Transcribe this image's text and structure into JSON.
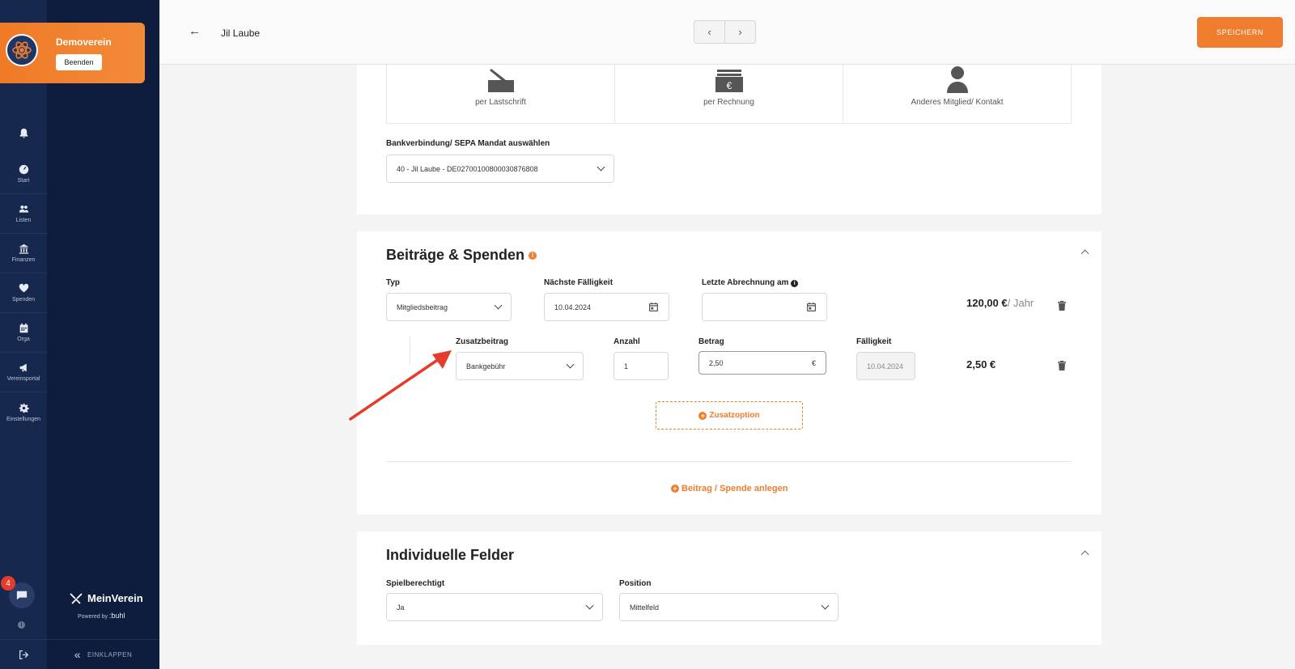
{
  "sidebar": {
    "org_name": "Demoverein",
    "org_button": "Beenden",
    "nav": [
      {
        "label": "",
        "icon": "bell-icon"
      },
      {
        "label": "Start",
        "icon": "dashboard-icon"
      },
      {
        "label": "Listen",
        "icon": "users-icon"
      },
      {
        "label": "Finanzen",
        "icon": "bank-icon"
      },
      {
        "label": "Spenden",
        "icon": "donation-icon"
      },
      {
        "label": "Orga",
        "icon": "calendar-icon"
      },
      {
        "label": "Vereinsportal",
        "icon": "megaphone-icon"
      },
      {
        "label": "Einstellungen",
        "icon": "gear-icon"
      }
    ],
    "chat_badge": "4",
    "brand": "MeinVerein",
    "powered_by": "Powered by",
    "powered_brand": ":buhl",
    "collapse_label": "EINKLAPPEN"
  },
  "header": {
    "back_icon": "←",
    "title": "Jil Laube",
    "save_label": "SPEICHERN"
  },
  "payment": {
    "options": [
      {
        "label": "per Lastschrift",
        "icon": "signature-icon"
      },
      {
        "label": "per Rechnung",
        "icon": "invoice-icon"
      },
      {
        "label": "Anderes Mitglied/ Kontakt",
        "icon": "person-icon"
      }
    ],
    "bank_label": "Bankverbindung/ SEPA Mandat auswählen",
    "bank_value": "40 - Jil Laube - DE02700100800030876808"
  },
  "contributions": {
    "title": "Beiträge & Spenden",
    "type_label": "Typ",
    "type_value": "Mitgliedsbeitrag",
    "due_label": "Nächste Fälligkeit",
    "due_value": "10.04.2024",
    "last_label": "Letzte Abrechnung am",
    "last_value": "",
    "amount": "120,00 €",
    "amount_period": "/ Jahr",
    "extra": {
      "label": "Zusatzbeitrag",
      "value": "Bankgebühr",
      "count_label": "Anzahl",
      "count_value": "1",
      "betrag_label": "Betrag",
      "betrag_value": "2,50",
      "currency": "€",
      "faellig_label": "Fälligkeit",
      "faellig_value": "10.04.2024",
      "amount": "2,50 €"
    },
    "add_option": "Zusatzoption",
    "add_contribution": "Beitrag / Spende anlegen"
  },
  "custom_fields": {
    "title": "Individuelle Felder",
    "field1_label": "Spielberechtigt",
    "field1_value": "Ja",
    "field2_label": "Position",
    "field2_value": "Mittelfeld"
  },
  "colors": {
    "accent": "#f07d2e",
    "sidebar": "#16284e",
    "annotation": "#e53b2d"
  }
}
